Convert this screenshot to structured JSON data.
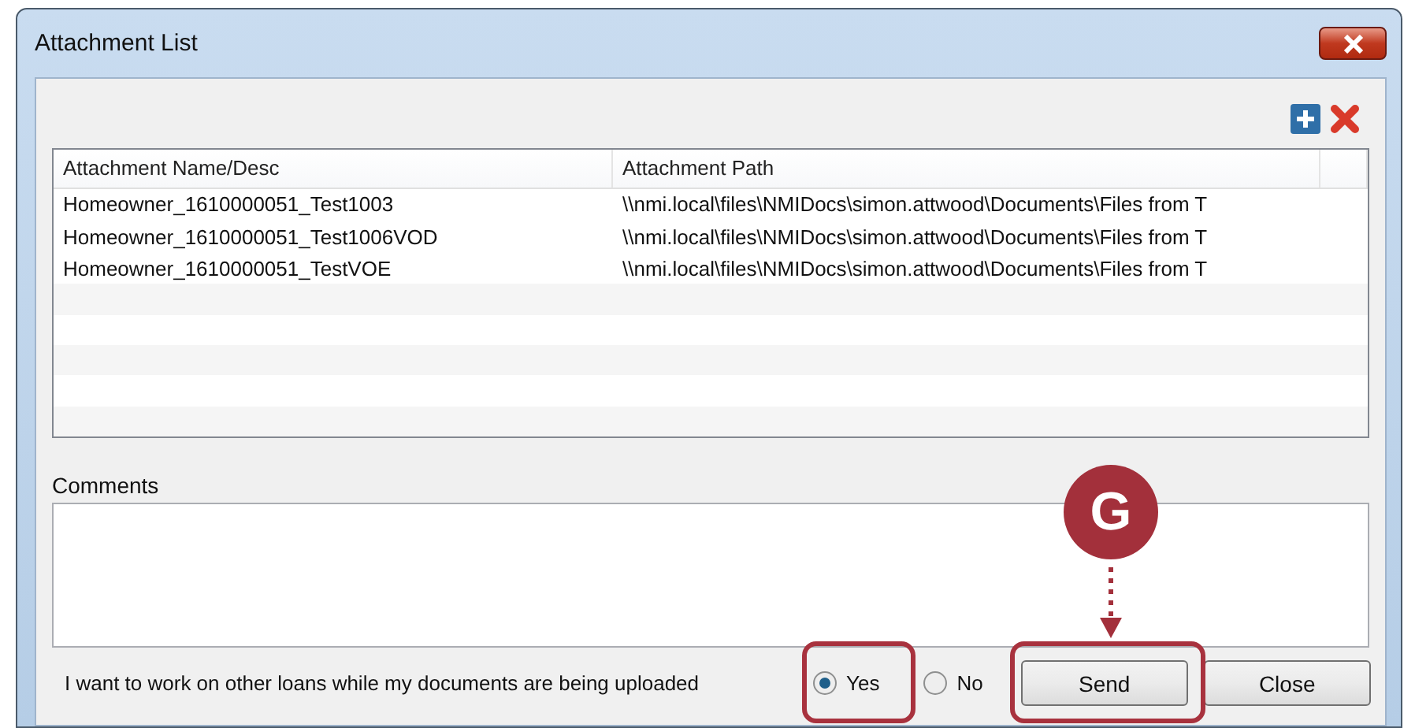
{
  "window": {
    "title": "Attachment List"
  },
  "toolbar": [
    {
      "kind": "add"
    },
    {
      "kind": "remove"
    }
  ],
  "table": {
    "columns": [
      "Attachment Name/Desc",
      "Attachment Path"
    ],
    "rows": [
      {
        "cells": [
          "Homeowner_1610000051_Test1003",
          "\\\\nmi.local\\files\\NMIDocs\\simon.attwood\\Documents\\Files from T"
        ]
      },
      {
        "cells": [
          "Homeowner_1610000051_Test1006VOD",
          "\\\\nmi.local\\files\\NMIDocs\\simon.attwood\\Documents\\Files from T"
        ]
      },
      {
        "cells": [
          "Homeowner_1610000051_TestVOE",
          "\\\\nmi.local\\files\\NMIDocs\\simon.attwood\\Documents\\Files from T"
        ]
      }
    ]
  },
  "comments": {
    "label": "Comments"
  },
  "upload_option": {
    "label": "I want to work on other loans while my documents are being uploaded",
    "options": [
      {
        "label": "Yes",
        "selected": true
      },
      {
        "label": "No",
        "selected": false
      }
    ]
  },
  "buttons": [
    "Send",
    "Close"
  ],
  "annotation": {
    "label": "G"
  }
}
